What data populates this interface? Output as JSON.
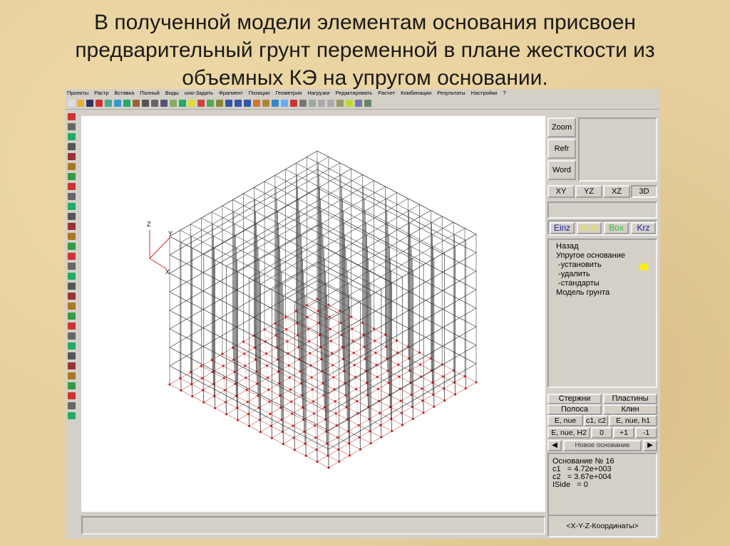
{
  "slide_title": "В полученной модели элементам основания присвоен предварительный грунт переменной в плане жесткости из объемных КЭ на упругом основании.",
  "menu": [
    "Проекты",
    "Растр",
    "Вставка",
    "Полный",
    "Виды",
    "uvw-Задать",
    "Фрагмент",
    "Позиции",
    "Геометрия",
    "Нагрузки",
    "Редактировать",
    "Расчет",
    "Комбинации",
    "Результаты",
    "Настройки",
    "?"
  ],
  "right_panel": {
    "view_buttons": [
      "Zoom",
      "Refr",
      "Word"
    ],
    "plane_tabs": [
      "XY",
      "YZ",
      "XZ",
      "3D"
    ],
    "mode_buttons": [
      {
        "label": "Einz",
        "color": "#1a1a9a"
      },
      {
        "label": "Auto",
        "color": "#e8e830"
      },
      {
        "label": "Box",
        "color": "#30c030"
      },
      {
        "label": "Krz",
        "color": "#1a1a9a"
      }
    ],
    "menu_items": [
      "Назад",
      "Упругое основание",
      " -установить",
      " -удалить",
      " -стандарты",
      "Модель грунта"
    ],
    "arrow_color": "#ffee00",
    "type_buttons": [
      "Стержни",
      "Пластины",
      "Полоса",
      "Клин"
    ],
    "param_buttons": [
      "E, nue",
      "c1, c2",
      "E, nue, h1",
      "E, nue, H2",
      "0",
      "+1",
      "-1"
    ],
    "nav_label": "Новое основание",
    "info_lines": [
      "Основание № 16",
      "c1   = 4.72e+003",
      "c2   = 3.67e+004",
      "ISide   = 0"
    ],
    "coords_button": "<X-Y-Z-Координаты>"
  },
  "axes": {
    "z": "Z",
    "y": "Y",
    "x": "X"
  }
}
